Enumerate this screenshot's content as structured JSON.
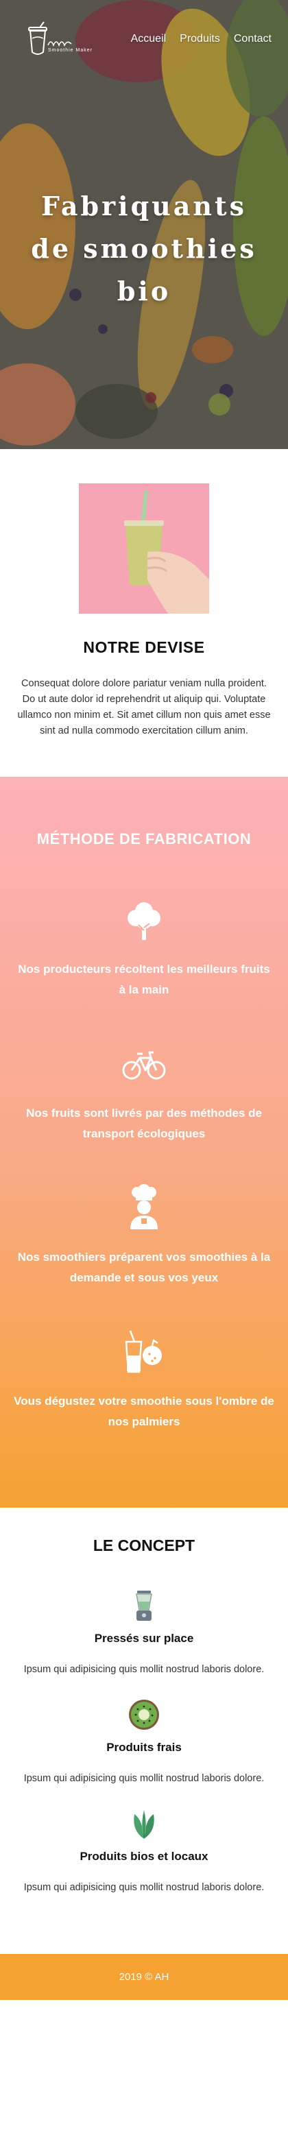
{
  "header": {
    "logo_text": "Smoothie Maker",
    "nav": [
      "Accueil",
      "Produits",
      "Contact"
    ]
  },
  "hero": {
    "title": "Fabriquants de smoothies bio"
  },
  "devise": {
    "title": "NOTRE DEVISE",
    "text": "Consequat dolore dolore pariatur veniam nulla proident. Do ut aute dolor id reprehendrit ut aliquip qui. Voluptate ullamco non minim et. Sit amet cillum non quis amet esse sint ad nulla commodo exercitation cillum anim."
  },
  "methode": {
    "title": "MÉTHODE DE FABRICATION",
    "steps": [
      {
        "icon": "tree-icon",
        "text": "Nos producteurs récoltent les meilleurs fruits à la main"
      },
      {
        "icon": "bicycle-icon",
        "text": "Nos fruits sont livrés par des méthodes de transport écologiques"
      },
      {
        "icon": "chef-icon",
        "text": "Nos smoothiers préparent vos smoothies à la demande et sous vos yeux"
      },
      {
        "icon": "drink-icon",
        "text": "Vous dégustez votre smoothie sous l'ombre de nos palmiers"
      }
    ]
  },
  "concept": {
    "title": "LE CONCEPT",
    "items": [
      {
        "icon": "blender-icon",
        "title": "Pressés sur place",
        "text": "Ipsum qui adipisicing quis mollit nostrud laboris dolore."
      },
      {
        "icon": "kiwi-icon",
        "title": "Produits frais",
        "text": "Ipsum qui adipisicing quis mollit nostrud laboris dolore."
      },
      {
        "icon": "leaf-icon",
        "title": "Produits bios et locaux",
        "text": "Ipsum qui adipisicing quis mollit nostrud laboris dolore."
      }
    ]
  },
  "footer": {
    "text": "2019 © AH"
  },
  "colors": {
    "accent_orange": "#f6a233",
    "pink_start": "#fdb1b9",
    "green_icon": "#8bb98a"
  }
}
